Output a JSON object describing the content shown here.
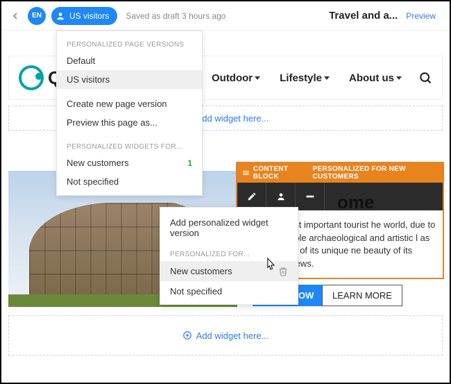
{
  "topbar": {
    "lang": "EN",
    "audience": "US visitors",
    "draft_status": "Saved as draft 3 hours ago",
    "page_title": "Travel and a...",
    "preview_label": "Preview"
  },
  "dropdown1": {
    "header1": "PERSONALIZED PAGE VERSIONS",
    "items1": [
      {
        "label": "Default"
      },
      {
        "label": "US visitors",
        "selected": true
      }
    ],
    "actions": [
      {
        "label": "Create new page version"
      },
      {
        "label": "Preview this page as..."
      }
    ],
    "header2": "PERSONALIZED WIDGETS FOR...",
    "items2": [
      {
        "label": "New customers",
        "count": "1"
      },
      {
        "label": "Not specified"
      }
    ]
  },
  "nav": {
    "logo_text": "Q",
    "items": [
      {
        "label": "Outdoor",
        "caret": true
      },
      {
        "label": "Lifestyle",
        "caret": true
      },
      {
        "label": "About us",
        "caret": true
      }
    ]
  },
  "add_widget_label": "Add widget here...",
  "content_block": {
    "tag1": "CONTENT BLOCK",
    "tag2": "PERSONALIZED FOR NEW CUSTOMERS",
    "title_fragment": "ome",
    "text": "ne of the most important tourist he world, due to the incalculable  archaeological and artistic l as for the charm of its unique ne beauty of its panoramic views."
  },
  "buttons": {
    "book": "BOOK NOW",
    "learn": "LEARN MORE"
  },
  "dropdown2": {
    "top": "Add personalized widget version",
    "header": "PERSONALIZED FOR...",
    "items": [
      {
        "label": "New customers",
        "selected": true,
        "trash": true
      },
      {
        "label": "Not specified"
      }
    ]
  }
}
